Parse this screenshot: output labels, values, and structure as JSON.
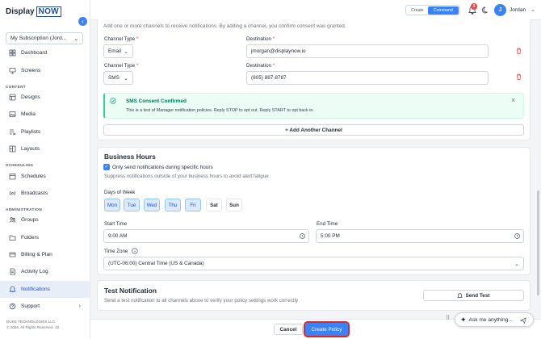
{
  "sidebar": {
    "logo_display": "Display",
    "logo_now": "NOW",
    "subscription": "My Subscription (Jord...",
    "items": [
      {
        "label": "Dashboard"
      },
      {
        "label": "Screens"
      },
      {
        "section": "CONTENT"
      },
      {
        "label": "Designs"
      },
      {
        "label": "Media"
      },
      {
        "label": "Playlists"
      },
      {
        "label": "Layouts"
      },
      {
        "section": "SCHEDULING"
      },
      {
        "label": "Schedules"
      },
      {
        "label": "Broadcasts"
      },
      {
        "section": "ADMINISTRATION"
      },
      {
        "label": "Groups"
      },
      {
        "label": "Folders"
      },
      {
        "label": "Billing & Plan"
      },
      {
        "label": "Activity Log"
      },
      {
        "label": "Notifications",
        "active": true
      },
      {
        "label": "Support"
      }
    ],
    "copyright_line1": "DUKE TECHNOLOGIES LLC",
    "copyright_line2": "© 2026. All Rights Reserved. 32"
  },
  "topbar": {
    "mode_create": "Create",
    "mode_command": "Command",
    "notification_count": "3",
    "avatar_initial": "J",
    "user_name": "Jordan"
  },
  "channels": {
    "intro": "Add one or more channels to receive notifications. By adding a channel, you confirm consent was granted.",
    "type_label": "Channel Type",
    "destination_label": "Destination",
    "required_mark": "*",
    "rows": [
      {
        "type": "Email",
        "destination": "jmorgan@displaynow.io"
      },
      {
        "type": "SMS",
        "destination": "(805) 887-8787"
      }
    ],
    "consent_title": "SMS Consent Confirmed",
    "consent_body": "This is a test of Manager notification policies. Reply STOP to opt out. Reply START to opt back in.",
    "add_channel": "+ Add Another Channel"
  },
  "business_hours": {
    "title": "Business Hours",
    "checkbox_label": "Only send notifications during specific hours",
    "helper": "Suppress notifications outside of your business hours to avoid alert fatigue",
    "days_label": "Days of Week",
    "days": [
      {
        "label": "Mon",
        "on": true
      },
      {
        "label": "Tue",
        "on": true
      },
      {
        "label": "Wed",
        "on": true
      },
      {
        "label": "Thu",
        "on": true
      },
      {
        "label": "Fri",
        "on": true
      },
      {
        "label": "Sat",
        "on": false
      },
      {
        "label": "Sun",
        "on": false
      }
    ],
    "start_label": "Start Time",
    "start_value": "9:00 AM",
    "end_label": "End Time",
    "end_value": "5:00 PM",
    "timezone_label": "Time Zone",
    "timezone_value": "(UTC-06:00) Central Time (US & Canada)"
  },
  "test_notification": {
    "title": "Test Notification",
    "helper": "Send a test notification to all channels above to verify your policy settings work correctly",
    "button": "Send Test"
  },
  "footer": {
    "cancel": "Cancel",
    "create": "Create Policy",
    "ask_placeholder": "Ask me anything..."
  },
  "colors": {
    "accent": "#3b82f6",
    "danger": "#ef4444",
    "success": "#10b981",
    "highlight_outline": "#dc2626"
  }
}
